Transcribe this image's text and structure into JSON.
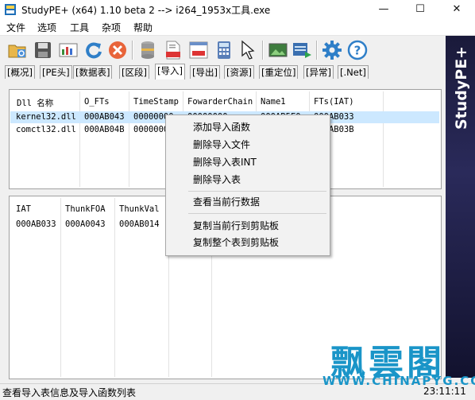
{
  "window": {
    "title": "StudyPE+ (x64) 1.10 beta 2 --> i264_1953x工具.exe",
    "minimize": "—",
    "maximize": "☐",
    "close": "✕"
  },
  "menu": [
    "文件",
    "选项",
    "工具",
    "杂项",
    "帮助"
  ],
  "toolbar_icons": [
    "open-file-icon",
    "save-icon",
    "screenshot-icon",
    "refresh-icon",
    "stop-icon",
    "database-icon",
    "asm-file-icon",
    "asm-window-icon",
    "calculator-icon",
    "pointer-icon",
    "image-icon",
    "export-icon",
    "settings-icon",
    "help-icon"
  ],
  "tabs": [
    "[概况]",
    "[PE头]",
    "[数据表]",
    "[区段]",
    "[导入]",
    "[导出]",
    "[资源]",
    "[重定位]",
    "[异常]",
    "[.Net]"
  ],
  "active_tab": "[导入]",
  "sidebar": {
    "logo": "StudyPE+"
  },
  "top_table": {
    "headers": [
      "Dll 名称",
      "O_FTs",
      "TimeStamp",
      "FowarderChain",
      "Name1",
      "FTs(IAT)"
    ],
    "rows": [
      [
        "kernel32.dll",
        "000AB043",
        "00000000",
        "00000000",
        "000AB5F0",
        "000AB033"
      ],
      [
        "comctl32.dll",
        "000AB04B",
        "00000000",
        "",
        "",
        "000AB03B"
      ]
    ]
  },
  "bottom_table": {
    "headers": [
      "IAT",
      "ThunkFOA",
      "ThunkVal"
    ],
    "rows": [
      [
        "000AB033",
        "000A0043",
        "000AB014"
      ]
    ]
  },
  "context_menu": {
    "items": [
      "添加导入函数",
      "删除导入文件",
      "删除导入表INT",
      "删除导入表",
      "查看当前行数据",
      "复制当前行到剪贴板",
      "复制整个表到剪贴板"
    ]
  },
  "status": {
    "message": "查看导入表信息及导入函数列表",
    "time": "23:11:11"
  },
  "watermark": {
    "chinese": "飘雲閣",
    "url": "WWW.CHINAPYG.COM"
  },
  "colors": {
    "selection": "#cce8ff",
    "watermark": "#1a95c8",
    "sidebar": "#1a1a3a"
  }
}
